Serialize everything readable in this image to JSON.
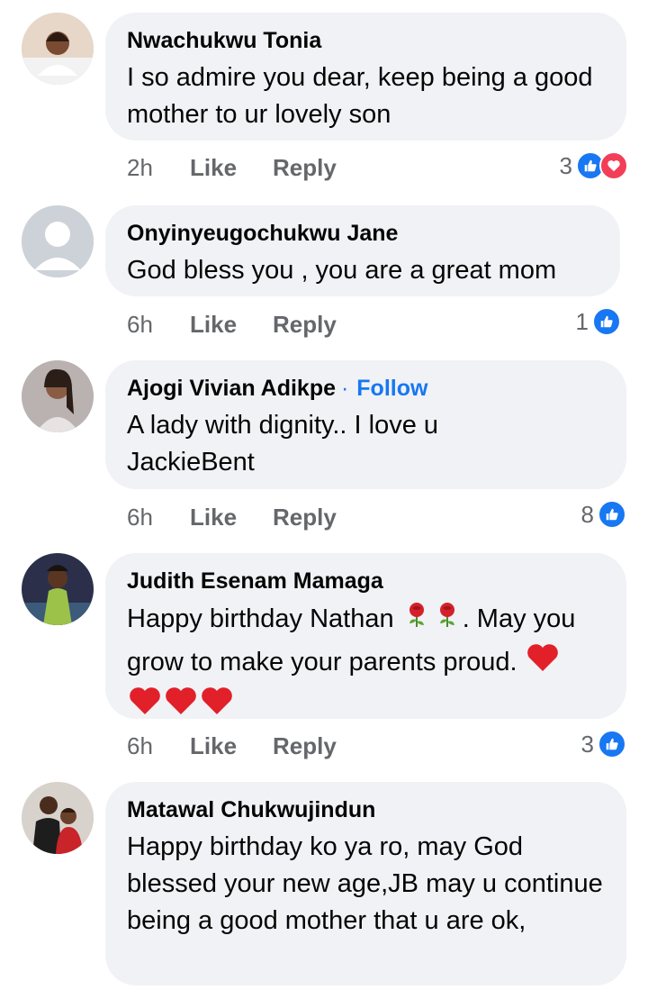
{
  "comments": [
    {
      "name": "Nwachukwu Tonia",
      "text": "I so admire you dear, keep being a good mother to ur lovely son",
      "time": "2h",
      "like_label": "Like",
      "reply_label": "Reply",
      "reaction_count": "3",
      "reactions": [
        "like-icon",
        "love-icon"
      ]
    },
    {
      "name": "Onyinyeugochukwu Jane",
      "text": "God bless you , you are a great mom",
      "time": "6h",
      "like_label": "Like",
      "reply_label": "Reply",
      "reaction_count": "1",
      "reactions": [
        "like-icon"
      ]
    },
    {
      "name": "Ajogi Vivian Adikpe",
      "follow_separator": "·",
      "follow_label": "Follow",
      "text": "A lady with dignity.. I love u JackieBent",
      "time": "6h",
      "like_label": "Like",
      "reply_label": "Reply",
      "reaction_count": "8",
      "reactions": [
        "like-icon"
      ]
    },
    {
      "name": "Judith Esenam Mamaga",
      "text_part1": "Happy birthday Nathan ",
      "text_part2": ". May you grow to make your parents proud. ",
      "emoji": [
        "rose-emoji",
        "heart-emoji"
      ],
      "time": "6h",
      "like_label": "Like",
      "reply_label": "Reply",
      "reaction_count": "3",
      "reactions": [
        "like-icon"
      ]
    },
    {
      "name": "Matawal Chukwujindun",
      "text": "Happy birthday ko ya ro, may God blessed your new age,JB may u continue being a good mother that u are ok,"
    }
  ],
  "colors": {
    "bubble": "#f0f2f5",
    "meta": "#65676b",
    "accent": "#1877f2",
    "love": "#f33e58"
  }
}
